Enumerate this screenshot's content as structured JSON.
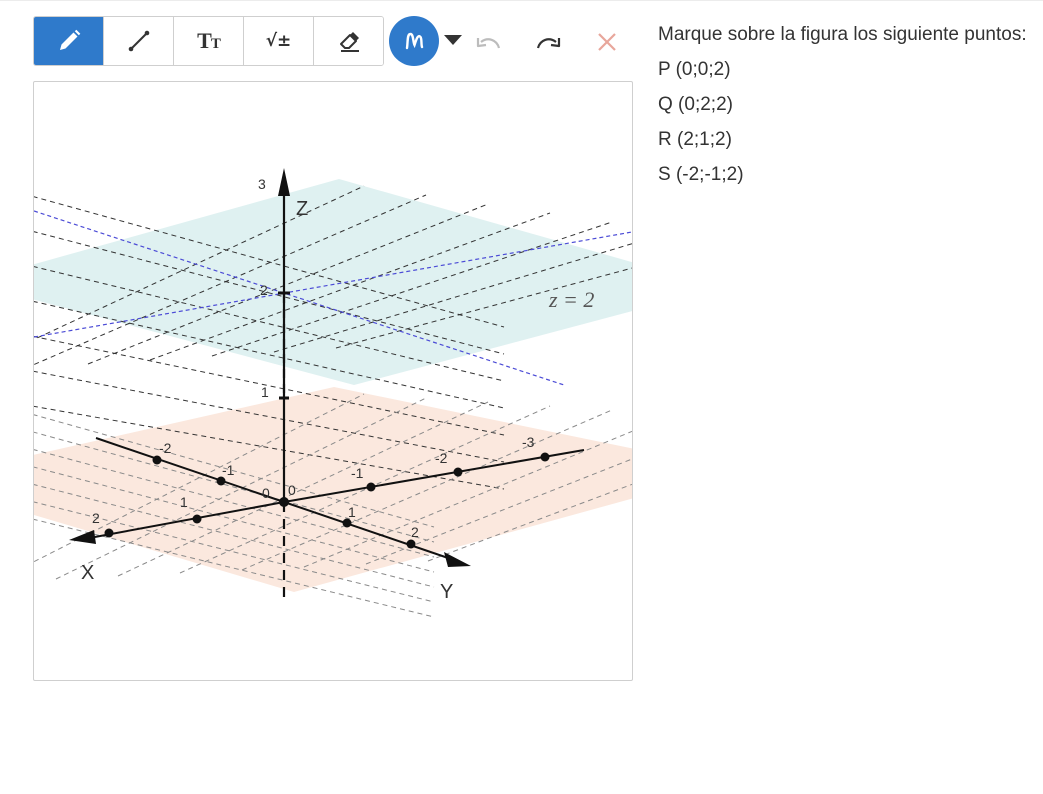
{
  "toolbar": {
    "tools": [
      {
        "name": "pen",
        "active": true
      },
      {
        "name": "line",
        "active": false
      },
      {
        "name": "text",
        "label": "TT",
        "active": false
      },
      {
        "name": "math",
        "label": "√±",
        "active": false
      },
      {
        "name": "eraser",
        "active": false
      }
    ],
    "lasso_active": true,
    "accent_color": "#2f7acb",
    "undo_enabled": false,
    "redo_enabled": true,
    "clear_color": "#e8a69b"
  },
  "question": {
    "prompt": "Marque sobre la figura los siguiente puntos:",
    "points": [
      "P (0;0;2)",
      "Q (0;2;2)",
      "R (2;1;2)",
      "S (-2;-1;2)"
    ]
  },
  "figure": {
    "axis_labels": {
      "x": "X",
      "y": "Y",
      "z": "Z"
    },
    "origin_label": "0",
    "origin_label_2": "0",
    "plane_label": "z = 2",
    "z_ticks": [
      "1",
      "2",
      "3"
    ],
    "x_ticks": [
      "1",
      "2",
      "-1",
      "-2"
    ],
    "y_ticks": [
      "1",
      "2",
      "-1",
      "-2",
      "-3"
    ],
    "colors": {
      "upper_plane": "#dff1f1",
      "lower_plane": "#fbe8de",
      "grid": "#333333",
      "blue_line": "#4b4bd6"
    }
  }
}
